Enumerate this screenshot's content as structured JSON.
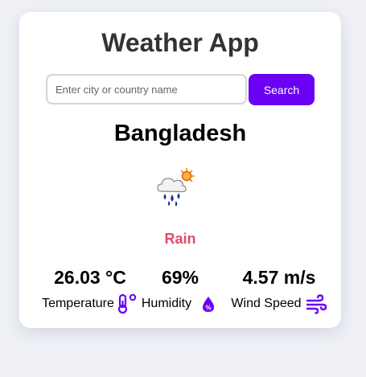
{
  "app": {
    "title": "Weather App"
  },
  "search": {
    "placeholder": "Enter city or country name",
    "value": "",
    "button_label": "Search"
  },
  "weather": {
    "location": "Bangladesh",
    "condition": "Rain",
    "icon": "rain-sun-cloud-icon"
  },
  "stats": {
    "temperature": {
      "value": "26.03 °C",
      "label": "Temperature",
      "icon": "thermometer-icon"
    },
    "humidity": {
      "value": "69%",
      "label": "Humidity",
      "icon": "humidity-drop-icon"
    },
    "wind": {
      "value": "4.57 m/s",
      "label": "Wind Speed",
      "icon": "wind-icon"
    }
  },
  "colors": {
    "background": "#eef0f6",
    "card": "#ffffff",
    "accent": "#6a00f4",
    "condition": "#e14b6f",
    "title": "#333333"
  }
}
